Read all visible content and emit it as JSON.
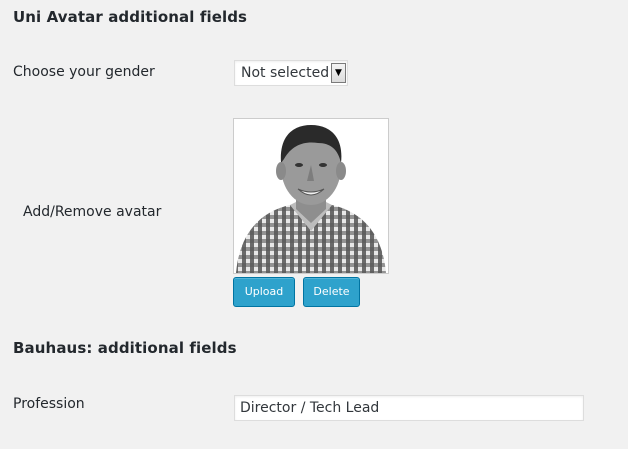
{
  "uni_avatar_section": {
    "title": "Uni Avatar additional fields",
    "gender_label": "Choose your gender",
    "gender_selected": "Not selected",
    "avatar_label": "Add/Remove avatar",
    "upload_label": "Upload",
    "delete_label": "Delete"
  },
  "bauhaus_section": {
    "title": "Bauhaus: additional fields",
    "profession_label": "Profession",
    "profession_value": "Director / Tech Lead"
  },
  "colors": {
    "background": "#f1f1f1",
    "button": "#2ea2cc",
    "button_border": "#0074a2",
    "text": "#23282d"
  }
}
